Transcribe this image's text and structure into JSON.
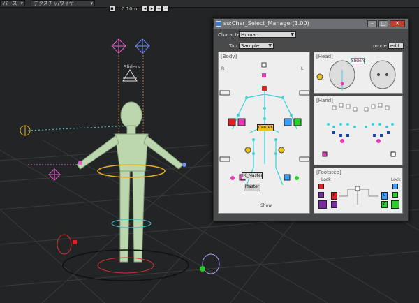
{
  "topbar": {
    "view_mode": "パース",
    "shading": "テクスチャ/ワイヤ",
    "zoom": "0.10m"
  },
  "viewport": {
    "sliders_label": "Sliders"
  },
  "window": {
    "title": "su:Char_Select_Manager(1.00)",
    "character_label": "Character",
    "character_value": "Human",
    "tab_label": "Tab",
    "tab_value": "Sample",
    "mode_label": "mode",
    "mode_value": "edit",
    "body": {
      "title": "[Body]",
      "r": "R",
      "l": "L",
      "center_label": "Center",
      "ik_master": "IK_Master",
      "master": "Master",
      "show": "Show",
      "ik_fk": "IK  FK",
      "set": "set",
      "ctrl": "ctrl"
    },
    "head": {
      "title": "[Head]",
      "sliders": "Sliders"
    },
    "hand": {
      "title": "[Hand]"
    },
    "footstep": {
      "title": "[Footstep]",
      "lock_left": "Lock",
      "lock_right": "Lock",
      "r": "R",
      "l": "L",
      "a": "A"
    }
  },
  "colors": {
    "viewport_bg": "#232425",
    "window_bg": "#494a4c",
    "panel_bg": "#eeeeee",
    "joint": "#35d4dc",
    "highlight_pink": "#e83ab8",
    "center_yellow": "#f2c21c",
    "red_ctrl": "#e02020",
    "green_ctrl": "#2ad02a",
    "blue_ctrl": "#3aa0ff"
  }
}
